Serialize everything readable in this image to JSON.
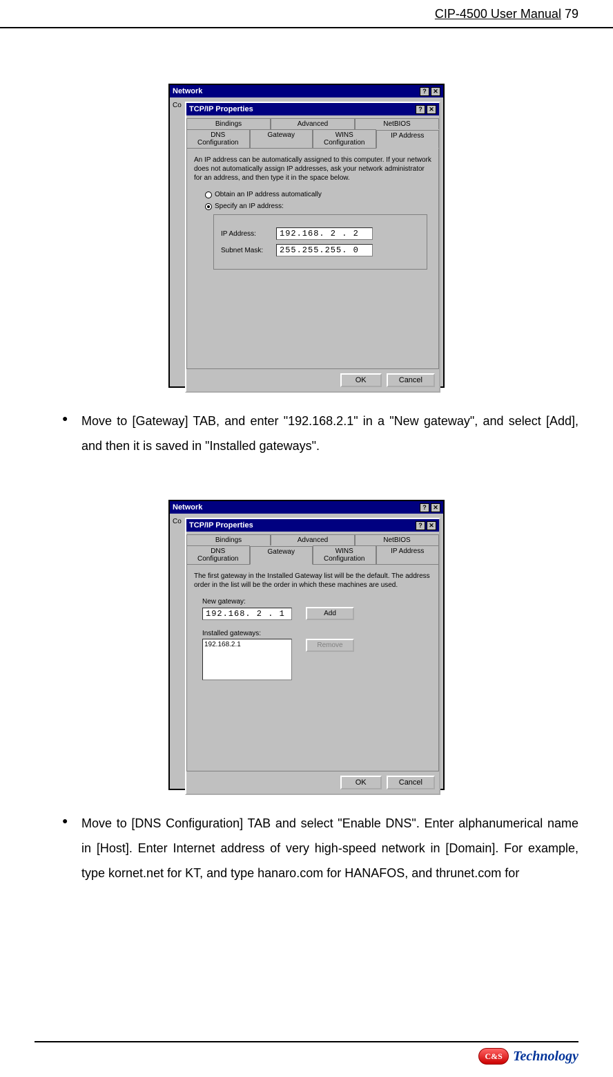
{
  "header": {
    "title": "CIP-4500 User Manual",
    "page": "79"
  },
  "dialog1": {
    "outer_title": "Network",
    "inner_title": "TCP/IP Properties",
    "tabs_top": [
      "Bindings",
      "Advanced",
      "NetBIOS"
    ],
    "tabs_bottom": [
      "DNS Configuration",
      "Gateway",
      "WINS Configuration",
      "IP Address"
    ],
    "active_tab": "IP Address",
    "help": "An IP address can be automatically assigned to this computer. If your network does not automatically assign IP addresses, ask your network administrator for an address, and then type it in the space below.",
    "radio_auto": "Obtain an IP address automatically",
    "radio_spec": "Specify an IP address:",
    "ip_label": "IP Address:",
    "ip_value": "192.168. 2 .  2",
    "mask_label": "Subnet Mask:",
    "mask_value": "255.255.255. 0",
    "ok": "OK",
    "cancel": "Cancel"
  },
  "bullet1": "Move to [Gateway] TAB, and enter \"192.168.2.1\" in a \"New gateway\", and select [Add], and then it is saved in \"Installed gateways\".",
  "dialog2": {
    "outer_title": "Network",
    "inner_title": "TCP/IP Properties",
    "tabs_top": [
      "Bindings",
      "Advanced",
      "NetBIOS"
    ],
    "tabs_bottom": [
      "DNS Configuration",
      "Gateway",
      "WINS Configuration",
      "IP Address"
    ],
    "active_tab": "Gateway",
    "help": "The first gateway in the Installed Gateway list will be the default. The address order in the list will be the order in which these machines are used.",
    "new_gw_label": "New gateway:",
    "new_gw_value": "192.168. 2 . 1",
    "add": "Add",
    "inst_label": "Installed gateways:",
    "inst_item": "192.168.2.1",
    "remove": "Remove",
    "ok": "OK",
    "cancel": "Cancel"
  },
  "bullet2": "Move to [DNS Configuration] TAB and select \"Enable DNS\". Enter alphanumerical name in [Host]. Enter Internet address of very high-speed network in [Domain]. For example, type kornet.net for KT, and type hanaro.com for HANAFOS, and thrunet.com for",
  "footer": {
    "badge": "C&S",
    "brand": "Technology"
  }
}
